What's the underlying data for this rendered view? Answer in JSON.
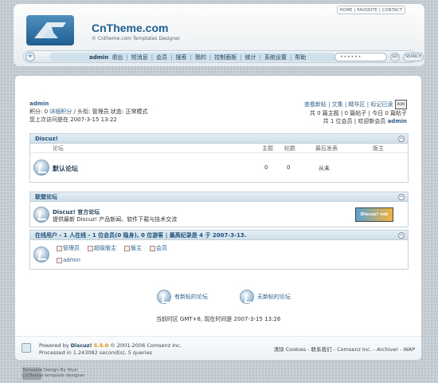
{
  "header": {
    "toplinks": [
      "HOME",
      "FAVORITE",
      "CONTACT"
    ],
    "brand": "CnTheme.com",
    "tagline": "© Cntheme.com Templates Designer"
  },
  "nav": {
    "user": "admin",
    "items": [
      "退出",
      "短消息",
      "会员",
      "搜索",
      "我的",
      "控制面板",
      "统计",
      "系统设置",
      "帮助"
    ],
    "search_placeholder": "••••••",
    "go_label": "GO",
    "search_label": "SEARCH"
  },
  "userinfo": {
    "name": "admin",
    "line2_prefix": "积分: ",
    "points": "0",
    "points_detail": " 详细积分",
    "title_prefix": " / 头衔: ",
    "title": "管理员",
    "status": " 状态: 正常模式",
    "last_visit_label": "您上次访问是在",
    "last_visit": "2007-3-15 13:22"
  },
  "rightinfo": {
    "links": "查看新帖 | 文集 | 精华区 | 标记已读",
    "skin_btn": "ROM",
    "stats": "共 0 篇主题 | 0 篇帖子 | 今日 0 篇帖子",
    "members_prefix": "共 1 位会员 | 欢迎新会员 ",
    "newest": "admin"
  },
  "discuz_panel": {
    "title": "Discuz!",
    "cols": [
      "论坛",
      "主题",
      "帖数",
      "最后发表",
      "版主"
    ],
    "forum_name": "默认论坛",
    "topics": "0",
    "posts": "0",
    "last_post": "从未"
  },
  "union_panel": {
    "title": "联盟论坛",
    "name": "Discuz! 官方论坛",
    "desc": "提供最新 Discuz! 产品新闻、软件下载与技术交流",
    "badge": "Discuz! net"
  },
  "online_panel": {
    "title": "在线用户 - 1 人在线 - 1 位会员(0 隐身), 0 位游客 | 最高纪录是 4 于 2007-3-13.",
    "legend": [
      "管理员",
      "超级版主",
      "版主",
      "会员"
    ],
    "users": [
      "admin"
    ]
  },
  "bottom": {
    "new_posts": "有新帖的论坛",
    "no_new_posts": "无新帖的论坛",
    "timezone": "当前时区 GMT+8, 现在时间是 2007-3-15 13:26"
  },
  "footer": {
    "powered_prefix": "Powered by ",
    "product": "Discuz!",
    "version": " 5.5.0",
    "copyright": " © 2001-2006 Comsenz Inc.",
    "processed": "Processed in 1.243082 second(s), 5 queries",
    "links": "清除 Cookies - 联系我们 - Comsenz Inc. - Archiver - WAP"
  },
  "credit": {
    "line1": "Template Design By Yoyo",
    "line2": "CnTheme template designer"
  }
}
